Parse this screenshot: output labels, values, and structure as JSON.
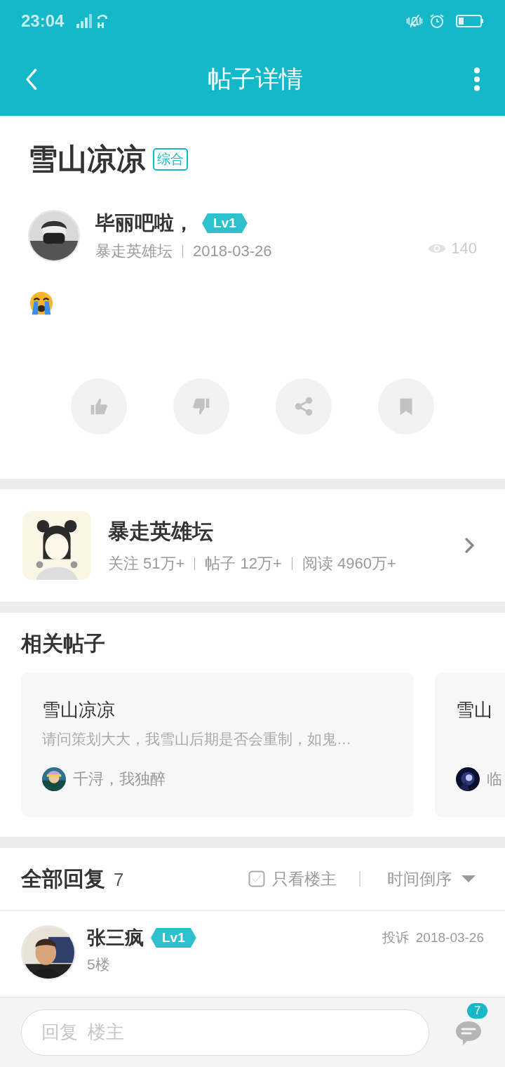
{
  "status_bar": {
    "time": "23:04"
  },
  "header": {
    "title": "帖子详情"
  },
  "post": {
    "title": "雪山凉凉",
    "tag": "综合",
    "author": {
      "name": "毕丽吧啦，",
      "level": "Lv1"
    },
    "forum": "暴走英雄坛",
    "date": "2018-03-26",
    "views": "140"
  },
  "actions": [
    {
      "kind": "like"
    },
    {
      "kind": "dislike"
    },
    {
      "kind": "share"
    },
    {
      "kind": "bookmark"
    }
  ],
  "forum_card": {
    "name": "暴走英雄坛",
    "stats": [
      "关注 51万+",
      "帖子 12万+",
      "阅读 4960万+"
    ]
  },
  "related": {
    "title": "相关帖子",
    "posts": [
      {
        "title": "雪山凉凉",
        "excerpt": "请问策划大大，我雪山后期是否会重制，如鬼…",
        "author": "千浔，我独醉"
      },
      {
        "title": "雪山",
        "author": "临"
      }
    ]
  },
  "replies": {
    "title": "全部回复",
    "count": "7",
    "owner_only": {
      "label": "只看楼主",
      "checked": false
    },
    "sort": "时间倒序",
    "items": [
      {
        "name": "张三疯",
        "level": "Lv1",
        "report": "投诉",
        "date": "2018-03-26",
        "floor": "5楼"
      }
    ]
  },
  "reply_bar": {
    "placeholder": "回复  楼主",
    "comment_count": "7"
  }
}
